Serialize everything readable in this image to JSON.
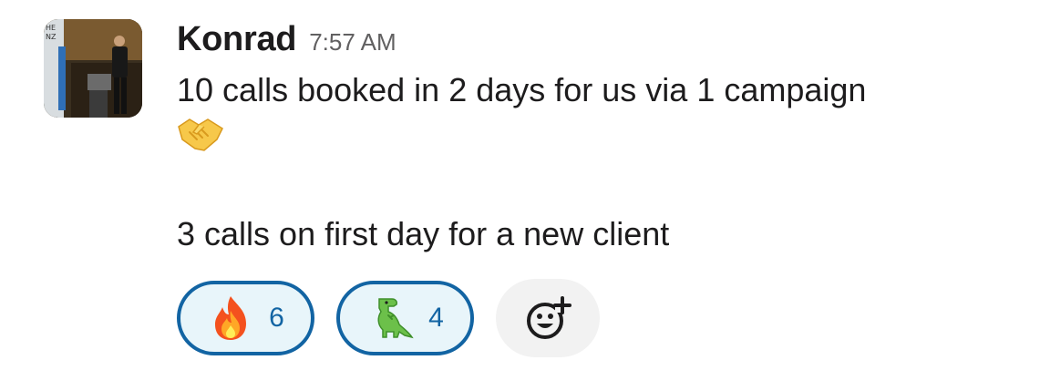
{
  "message": {
    "sender": "Konrad",
    "timestamp": "7:57 AM",
    "line1": "10 calls booked in 2 days for us via 1 campaign",
    "emoji_inline": "handshake-icon",
    "line2": "3 calls on first day for a new client"
  },
  "reactions": [
    {
      "emoji": "fire-icon",
      "count": "6",
      "selected": true
    },
    {
      "emoji": "t-rex-icon",
      "count": "4",
      "selected": true
    }
  ],
  "add_reaction": {
    "icon": "add-reaction-icon"
  },
  "colors": {
    "accent": "#1264a3",
    "reaction_bg": "#e8f5fa",
    "text": "#1d1c1d",
    "timestamp": "#616061",
    "add_bg": "#f2f2f2"
  }
}
